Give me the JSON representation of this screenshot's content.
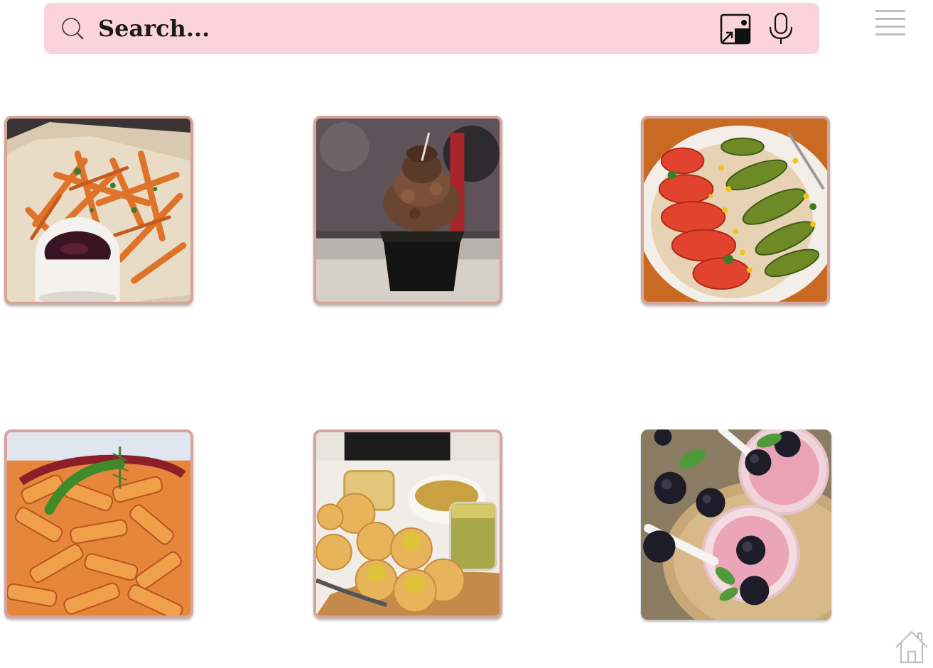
{
  "search": {
    "placeholder": "Search..."
  },
  "icons": {
    "search": "search-icon",
    "image_search": "image-search-icon",
    "voice": "microphone-icon",
    "menu": "hamburger-menu-icon",
    "home": "home-icon"
  },
  "colors": {
    "search_bar_bg": "#fbd3dc",
    "tile_border": "#d6a49b"
  },
  "tiles": [
    {
      "item": "fries-with-dip"
    },
    {
      "item": "chocolate-dessert"
    },
    {
      "item": "tomato-avocado-salad"
    },
    {
      "item": "penne-pasta"
    },
    {
      "item": "pani-puri"
    },
    {
      "item": "blackberry-smoothie"
    }
  ]
}
